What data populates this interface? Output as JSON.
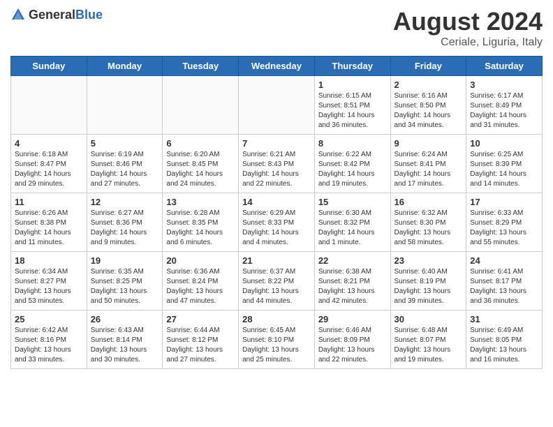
{
  "header": {
    "logo_general": "General",
    "logo_blue": "Blue",
    "main_title": "August 2024",
    "subtitle": "Ceriale, Liguria, Italy"
  },
  "days_of_week": [
    "Sunday",
    "Monday",
    "Tuesday",
    "Wednesday",
    "Thursday",
    "Friday",
    "Saturday"
  ],
  "weeks": [
    [
      {
        "day": "",
        "info": ""
      },
      {
        "day": "",
        "info": ""
      },
      {
        "day": "",
        "info": ""
      },
      {
        "day": "",
        "info": ""
      },
      {
        "day": "1",
        "info": "Sunrise: 6:15 AM\nSunset: 8:51 PM\nDaylight: 14 hours\nand 36 minutes."
      },
      {
        "day": "2",
        "info": "Sunrise: 6:16 AM\nSunset: 8:50 PM\nDaylight: 14 hours\nand 34 minutes."
      },
      {
        "day": "3",
        "info": "Sunrise: 6:17 AM\nSunset: 8:49 PM\nDaylight: 14 hours\nand 31 minutes."
      }
    ],
    [
      {
        "day": "4",
        "info": "Sunrise: 6:18 AM\nSunset: 8:47 PM\nDaylight: 14 hours\nand 29 minutes."
      },
      {
        "day": "5",
        "info": "Sunrise: 6:19 AM\nSunset: 8:46 PM\nDaylight: 14 hours\nand 27 minutes."
      },
      {
        "day": "6",
        "info": "Sunrise: 6:20 AM\nSunset: 8:45 PM\nDaylight: 14 hours\nand 24 minutes."
      },
      {
        "day": "7",
        "info": "Sunrise: 6:21 AM\nSunset: 8:43 PM\nDaylight: 14 hours\nand 22 minutes."
      },
      {
        "day": "8",
        "info": "Sunrise: 6:22 AM\nSunset: 8:42 PM\nDaylight: 14 hours\nand 19 minutes."
      },
      {
        "day": "9",
        "info": "Sunrise: 6:24 AM\nSunset: 8:41 PM\nDaylight: 14 hours\nand 17 minutes."
      },
      {
        "day": "10",
        "info": "Sunrise: 6:25 AM\nSunset: 8:39 PM\nDaylight: 14 hours\nand 14 minutes."
      }
    ],
    [
      {
        "day": "11",
        "info": "Sunrise: 6:26 AM\nSunset: 8:38 PM\nDaylight: 14 hours\nand 11 minutes."
      },
      {
        "day": "12",
        "info": "Sunrise: 6:27 AM\nSunset: 8:36 PM\nDaylight: 14 hours\nand 9 minutes."
      },
      {
        "day": "13",
        "info": "Sunrise: 6:28 AM\nSunset: 8:35 PM\nDaylight: 14 hours\nand 6 minutes."
      },
      {
        "day": "14",
        "info": "Sunrise: 6:29 AM\nSunset: 8:33 PM\nDaylight: 14 hours\nand 4 minutes."
      },
      {
        "day": "15",
        "info": "Sunrise: 6:30 AM\nSunset: 8:32 PM\nDaylight: 14 hours\nand 1 minute."
      },
      {
        "day": "16",
        "info": "Sunrise: 6:32 AM\nSunset: 8:30 PM\nDaylight: 13 hours\nand 58 minutes."
      },
      {
        "day": "17",
        "info": "Sunrise: 6:33 AM\nSunset: 8:29 PM\nDaylight: 13 hours\nand 55 minutes."
      }
    ],
    [
      {
        "day": "18",
        "info": "Sunrise: 6:34 AM\nSunset: 8:27 PM\nDaylight: 13 hours\nand 53 minutes."
      },
      {
        "day": "19",
        "info": "Sunrise: 6:35 AM\nSunset: 8:25 PM\nDaylight: 13 hours\nand 50 minutes."
      },
      {
        "day": "20",
        "info": "Sunrise: 6:36 AM\nSunset: 8:24 PM\nDaylight: 13 hours\nand 47 minutes."
      },
      {
        "day": "21",
        "info": "Sunrise: 6:37 AM\nSunset: 8:22 PM\nDaylight: 13 hours\nand 44 minutes."
      },
      {
        "day": "22",
        "info": "Sunrise: 6:38 AM\nSunset: 8:21 PM\nDaylight: 13 hours\nand 42 minutes."
      },
      {
        "day": "23",
        "info": "Sunrise: 6:40 AM\nSunset: 8:19 PM\nDaylight: 13 hours\nand 39 minutes."
      },
      {
        "day": "24",
        "info": "Sunrise: 6:41 AM\nSunset: 8:17 PM\nDaylight: 13 hours\nand 36 minutes."
      }
    ],
    [
      {
        "day": "25",
        "info": "Sunrise: 6:42 AM\nSunset: 8:16 PM\nDaylight: 13 hours\nand 33 minutes."
      },
      {
        "day": "26",
        "info": "Sunrise: 6:43 AM\nSunset: 8:14 PM\nDaylight: 13 hours\nand 30 minutes."
      },
      {
        "day": "27",
        "info": "Sunrise: 6:44 AM\nSunset: 8:12 PM\nDaylight: 13 hours\nand 27 minutes."
      },
      {
        "day": "28",
        "info": "Sunrise: 6:45 AM\nSunset: 8:10 PM\nDaylight: 13 hours\nand 25 minutes."
      },
      {
        "day": "29",
        "info": "Sunrise: 6:46 AM\nSunset: 8:09 PM\nDaylight: 13 hours\nand 22 minutes."
      },
      {
        "day": "30",
        "info": "Sunrise: 6:48 AM\nSunset: 8:07 PM\nDaylight: 13 hours\nand 19 minutes."
      },
      {
        "day": "31",
        "info": "Sunrise: 6:49 AM\nSunset: 8:05 PM\nDaylight: 13 hours\nand 16 minutes."
      }
    ]
  ]
}
